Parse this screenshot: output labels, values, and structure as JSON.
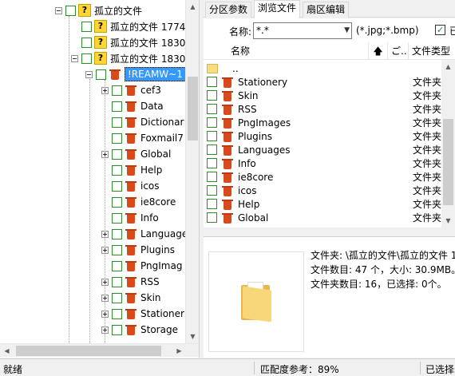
{
  "tree": {
    "nodes": [
      {
        "label": "孤立的文件",
        "icon": "question-icon",
        "expander": "minus"
      },
      {
        "label": "孤立的文件 1774",
        "icon": "question-icon",
        "expander": ""
      },
      {
        "label": "孤立的文件 1830",
        "icon": "question-icon",
        "expander": ""
      },
      {
        "label": "孤立的文件 1830",
        "icon": "question-icon",
        "expander": "minus"
      },
      {
        "label": "!REAMW~1",
        "icon": "recycle-bin-icon",
        "expander": "minus",
        "selected": true
      },
      {
        "label": "cef3",
        "icon": "recycle-bin-icon",
        "expander": "plus"
      },
      {
        "label": "Data",
        "icon": "recycle-bin-icon",
        "expander": ""
      },
      {
        "label": "Dictionar",
        "icon": "recycle-bin-icon",
        "expander": ""
      },
      {
        "label": "Foxmail7",
        "icon": "recycle-bin-icon",
        "expander": ""
      },
      {
        "label": "Global",
        "icon": "recycle-bin-icon",
        "expander": "plus"
      },
      {
        "label": "Help",
        "icon": "recycle-bin-icon",
        "expander": ""
      },
      {
        "label": "icos",
        "icon": "recycle-bin-icon",
        "expander": ""
      },
      {
        "label": "ie8core",
        "icon": "recycle-bin-icon",
        "expander": ""
      },
      {
        "label": "Info",
        "icon": "recycle-bin-icon",
        "expander": ""
      },
      {
        "label": "Language",
        "icon": "recycle-bin-icon",
        "expander": "plus"
      },
      {
        "label": "Plugins",
        "icon": "recycle-bin-icon",
        "expander": "plus"
      },
      {
        "label": "PngImag",
        "icon": "recycle-bin-icon",
        "expander": ""
      },
      {
        "label": "RSS",
        "icon": "recycle-bin-icon",
        "expander": "plus"
      },
      {
        "label": "Skin",
        "icon": "recycle-bin-icon",
        "expander": "plus"
      },
      {
        "label": "Stationer",
        "icon": "recycle-bin-icon",
        "expander": "plus"
      },
      {
        "label": "Storage",
        "icon": "recycle-bin-icon",
        "expander": "plus"
      }
    ]
  },
  "tabs": [
    {
      "label": "分区参数",
      "active": false
    },
    {
      "label": "浏览文件",
      "active": true
    },
    {
      "label": "扇区编辑",
      "active": false
    }
  ],
  "filter": {
    "name_label": "名称:",
    "name_value": "*.*",
    "hint": "(*.jpg;*.bmp)",
    "check_label": "已"
  },
  "list": {
    "headers": {
      "name": "名称",
      "col2": "ご...",
      "type": "文件类型"
    },
    "parent_label": "..",
    "rows": [
      {
        "name": "Stationery",
        "type": "文件夹"
      },
      {
        "name": "Skin",
        "type": "文件夹"
      },
      {
        "name": "RSS",
        "type": "文件夹"
      },
      {
        "name": "PngImages",
        "type": "文件夹"
      },
      {
        "name": "Plugins",
        "type": "文件夹"
      },
      {
        "name": "Languages",
        "type": "文件夹"
      },
      {
        "name": "Info",
        "type": "文件夹"
      },
      {
        "name": "ie8core",
        "type": "文件夹"
      },
      {
        "name": "icos",
        "type": "文件夹"
      },
      {
        "name": "Help",
        "type": "文件夹"
      },
      {
        "name": "Global",
        "type": "文件夹"
      }
    ]
  },
  "info": {
    "folder_line": "文件夹: \\孤立的文件\\孤立的文件 1",
    "files_line": "文件数目: 47 个，大小: 30.9MB。",
    "subfolders_line": "文件夹数目: 16，已选择: 0个。"
  },
  "status": {
    "ready": "就绪",
    "match_ref": "匹配度参考：89%",
    "selected": "已选择"
  },
  "colors": {
    "selection": "#3399ff",
    "checkbox_border": "#2c8f2c",
    "recycle_bin_red": "#d84a1b"
  }
}
